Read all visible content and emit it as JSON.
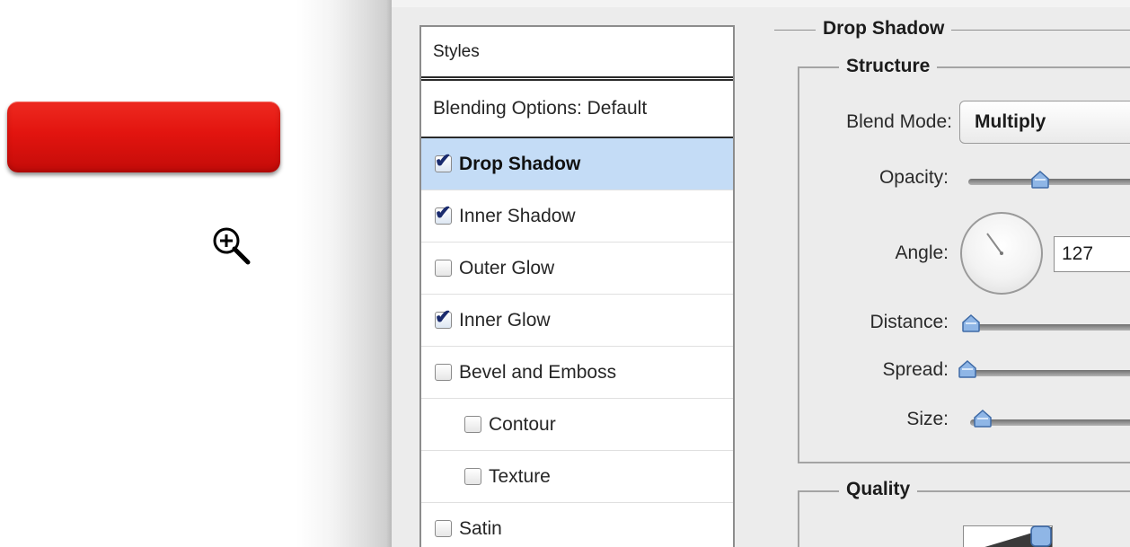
{
  "styles_panel": {
    "header": "Styles",
    "blending_options": "Blending Options: Default",
    "items": [
      {
        "label": "Drop Shadow",
        "checked": true,
        "selected": true
      },
      {
        "label": "Inner Shadow",
        "checked": true,
        "selected": false
      },
      {
        "label": "Outer Glow",
        "checked": false,
        "selected": false
      },
      {
        "label": "Inner Glow",
        "checked": true,
        "selected": false
      },
      {
        "label": "Bevel and Emboss",
        "checked": false,
        "selected": false
      },
      {
        "label": "Contour",
        "checked": false,
        "selected": false,
        "sub": true
      },
      {
        "label": "Texture",
        "checked": false,
        "selected": false,
        "sub": true
      },
      {
        "label": "Satin",
        "checked": false,
        "selected": false
      }
    ]
  },
  "drop_shadow": {
    "title": "Drop Shadow",
    "structure": {
      "title": "Structure",
      "blend_mode_label": "Blend Mode:",
      "blend_mode_value": "Multiply",
      "opacity_label": "Opacity:",
      "angle_label": "Angle:",
      "angle_value": "127",
      "distance_label": "Distance:",
      "spread_label": "Spread:",
      "size_label": "Size:"
    },
    "quality": {
      "title": "Quality"
    }
  },
  "colors": {
    "accent_selection": "#c4dcf6",
    "button_red": "#e2140f",
    "checkmark": "#1a2b6e"
  }
}
